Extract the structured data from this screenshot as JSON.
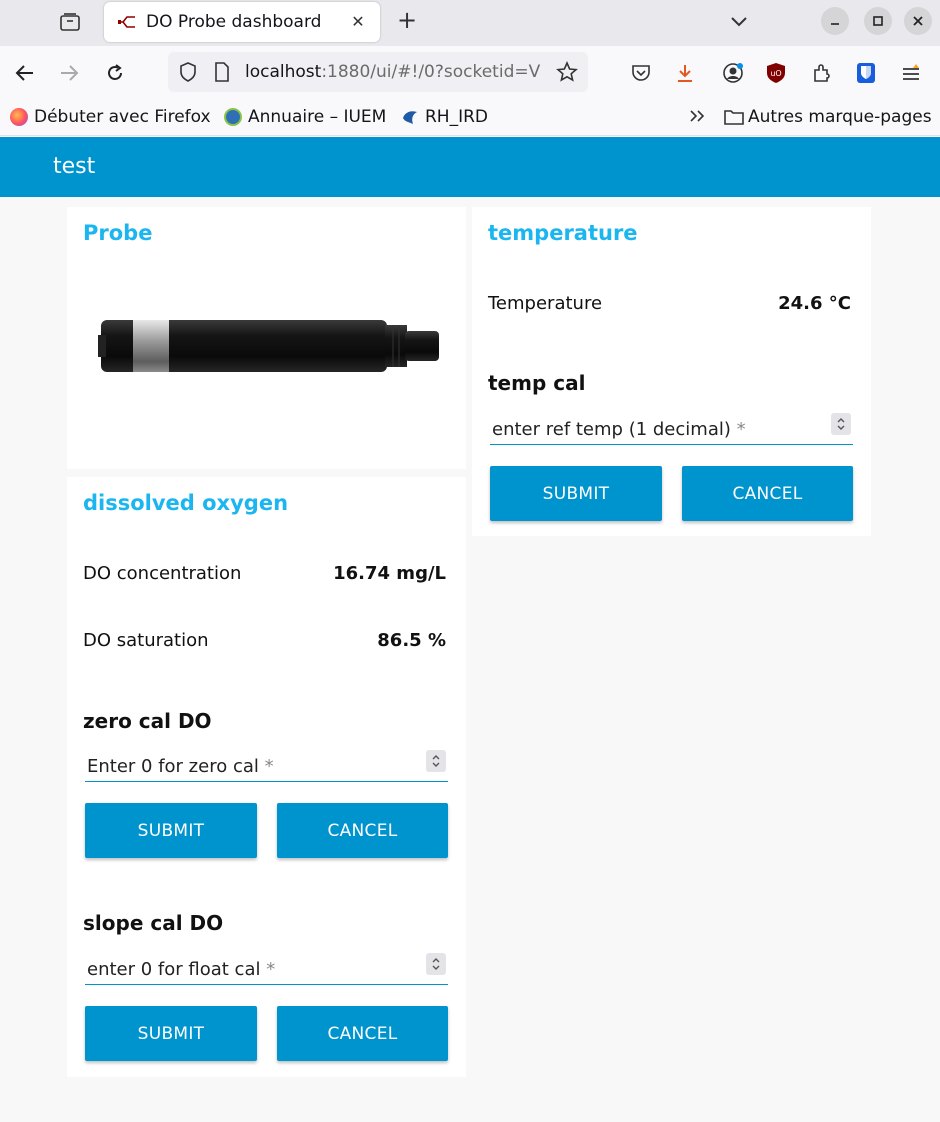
{
  "browser": {
    "tab_title": "DO Probe dashboard",
    "url_host": "localhost",
    "url_rest": ":1880/ui/#!/0?socketid=V",
    "bookmarks": [
      {
        "label": "Débuter avec Firefox"
      },
      {
        "label": "Annuaire – IUEM"
      },
      {
        "label": "RH_IRD"
      }
    ],
    "other_bookmarks": "Autres marque-pages"
  },
  "app": {
    "title": "test",
    "accent": "#0094ce",
    "header_color": "#1bb6f0"
  },
  "probe_card": {
    "title": "Probe"
  },
  "do_card": {
    "title": "dissolved oxygen",
    "concentration_label": "DO concentration",
    "concentration_value": "16.74 mg/L",
    "saturation_label": "DO saturation",
    "saturation_value": "86.5 %",
    "zero_cal": {
      "heading": "zero cal DO",
      "placeholder": "Enter 0 for zero cal",
      "required": "*",
      "submit": "SUBMIT",
      "cancel": "CANCEL"
    },
    "slope_cal": {
      "heading": "slope cal DO",
      "placeholder": "enter 0 for float cal",
      "required": "*",
      "submit": "SUBMIT",
      "cancel": "CANCEL"
    }
  },
  "temp_card": {
    "title": "temperature",
    "temp_label": "Temperature",
    "temp_value": "24.6 °C",
    "cal": {
      "heading": "temp cal",
      "placeholder": "enter ref temp (1 decimal)",
      "required": "*",
      "submit": "SUBMIT",
      "cancel": "CANCEL"
    }
  }
}
